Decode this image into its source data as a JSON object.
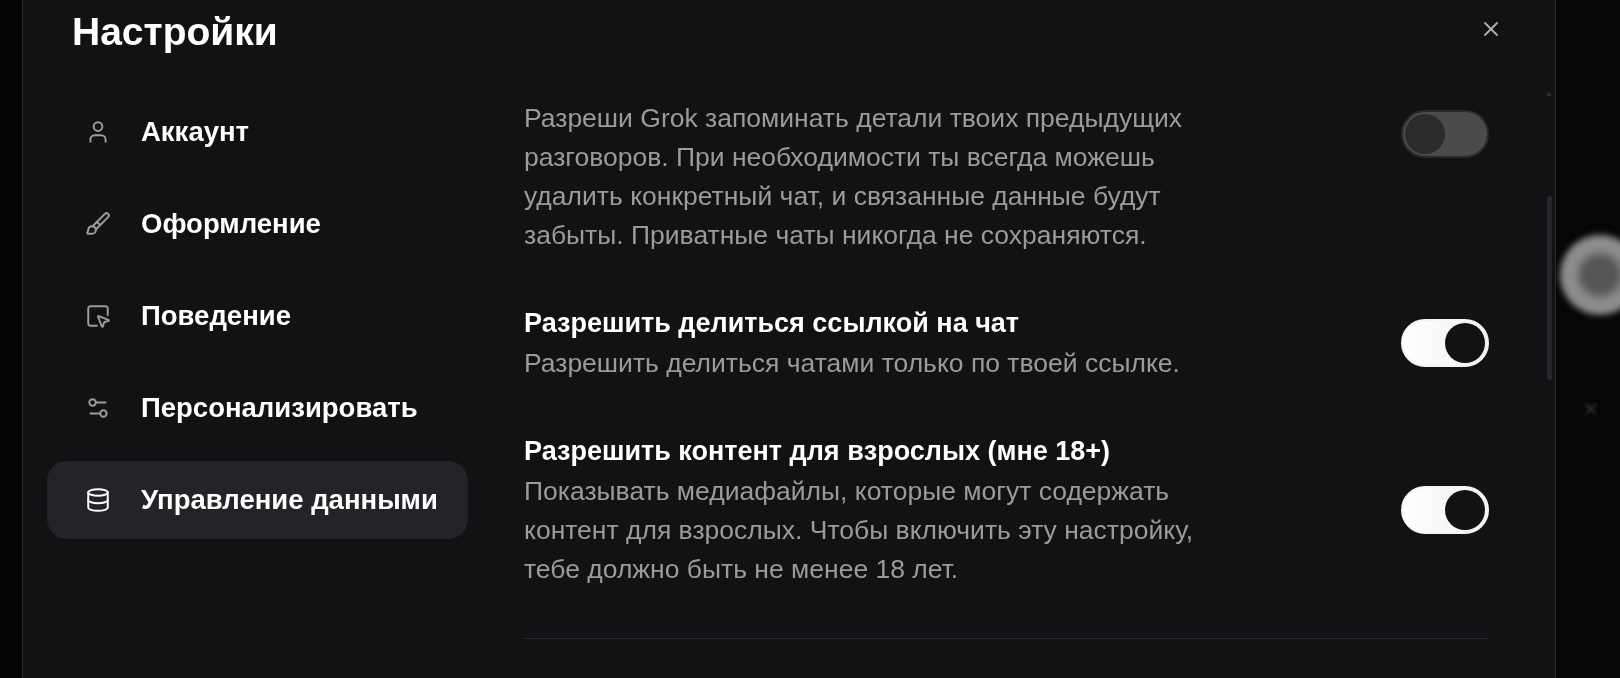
{
  "dialog": {
    "title": "Настройки"
  },
  "sidebar": {
    "items": [
      {
        "kind": "account",
        "label": "Аккаунт",
        "selected": false
      },
      {
        "kind": "appearance",
        "label": "Оформление",
        "selected": false
      },
      {
        "kind": "behavior",
        "label": "Поведение",
        "selected": false
      },
      {
        "kind": "customize",
        "label": "Персонализировать",
        "selected": false
      },
      {
        "kind": "data",
        "label": "Управление данными",
        "selected": true
      }
    ]
  },
  "settings": [
    {
      "description": "Разреши Grok запоминать детали твоих предыдущих разговоров. При необходимости ты всегда можешь удалить конкретный чат, и связанные данные будут забыты. Приватные чаты никогда не сохраняются.",
      "on": false
    },
    {
      "title": "Разрешить делиться ссылкой на чат",
      "description": "Разрешить делиться чатами только по твоей ссылке.",
      "on": true
    },
    {
      "title": "Разрешить контент для взрослых (мне 18+)",
      "description": "Показывать медиафайлы, которые могут содержать контент для взрослых. Чтобы включить эту настройку, тебе должно быть не менее 18 лет.",
      "on": true
    }
  ]
}
